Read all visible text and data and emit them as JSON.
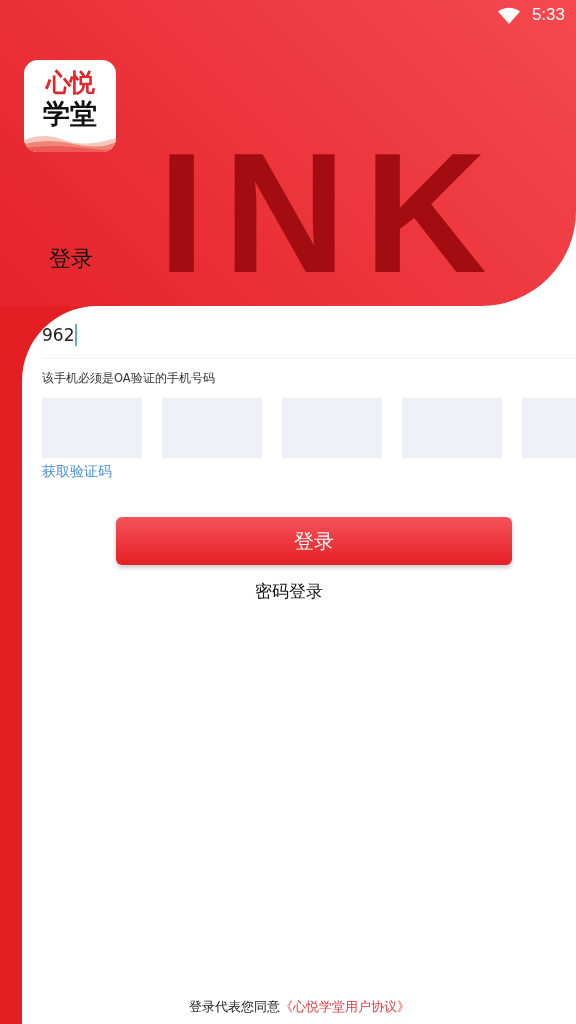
{
  "status_bar": {
    "time": "5:33"
  },
  "logo": {
    "line_1": "心悦",
    "line_2": "学堂"
  },
  "background_text": "INK",
  "title": "登录",
  "phone_field": {
    "value": "962",
    "focused": true
  },
  "hint": "该手机必须是OA验证的手机号码",
  "code_boxes": [
    {
      "focused": false
    },
    {
      "focused": false
    },
    {
      "focused": false
    },
    {
      "focused": false
    },
    {
      "focused": false
    }
  ],
  "get_code_link": "获取验证码",
  "login_button": "登录",
  "password_login_link": "密码登录",
  "footer": {
    "text": "登录代表您同意",
    "agreement_link": "《心悦学堂用户协议》"
  }
}
